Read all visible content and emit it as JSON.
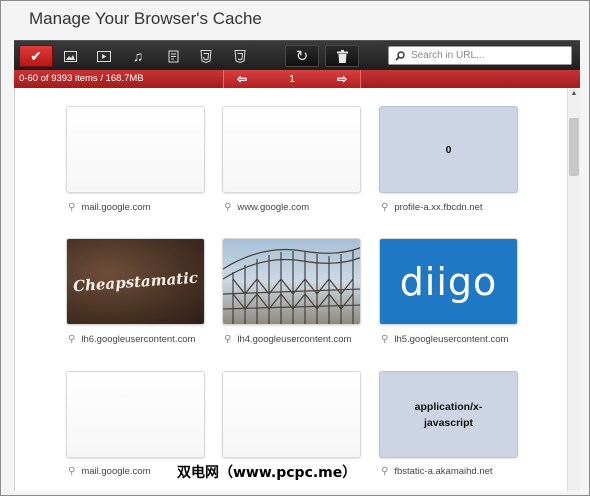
{
  "window": {
    "title": "Manage Your Browser's Cache"
  },
  "toolbar": {
    "buttons": [
      {
        "name": "select-all-button",
        "icon": "checkmark-icon",
        "glyph": "✔"
      },
      {
        "name": "filter-images-button",
        "icon": "image-icon",
        "glyph": "▣"
      },
      {
        "name": "filter-video-button",
        "icon": "video-icon",
        "glyph": "▶"
      },
      {
        "name": "filter-audio-button",
        "icon": "music-icon",
        "glyph": "♫"
      },
      {
        "name": "filter-scripts-button",
        "icon": "script-icon",
        "glyph": "§"
      },
      {
        "name": "filter-html5-button",
        "icon": "html5-icon",
        "glyph": "5"
      },
      {
        "name": "filter-css3-button",
        "icon": "css3-icon",
        "glyph": "3"
      }
    ],
    "refresh_glyph": "↻",
    "delete_glyph": "🗑",
    "search_placeholder": "Search in URL..."
  },
  "status": {
    "count_text": "0-60 of 9393 items / 168.7MB",
    "page": "1",
    "prev_glyph": "⇦",
    "next_glyph": "⇨"
  },
  "items": [
    {
      "kind": "blank",
      "caption": "mail.google.com"
    },
    {
      "kind": "blank",
      "caption": "www.google.com"
    },
    {
      "kind": "text",
      "text": "0",
      "caption": "profile-a.xx.fbcdn.net"
    },
    {
      "kind": "cheapstamatic",
      "text": "Cheapstamatic",
      "caption": "lh6.googleusercontent.com"
    },
    {
      "kind": "coaster",
      "caption": "lh4.googleusercontent.com"
    },
    {
      "kind": "diigo",
      "text": "diigo",
      "caption": "lh5.googleusercontent.com"
    },
    {
      "kind": "blank",
      "caption": "mail.google.com"
    },
    {
      "kind": "blank",
      "caption": ""
    },
    {
      "kind": "text",
      "text": "application/x-javascript",
      "caption": "fbstatic-a.akamaihd.net"
    }
  ],
  "watermark": "双电网（www.pcpc.me）",
  "colors": {
    "accent_red": "#c62828",
    "toolbar_dark": "#222222",
    "mime_card": "#cdd5e5"
  }
}
